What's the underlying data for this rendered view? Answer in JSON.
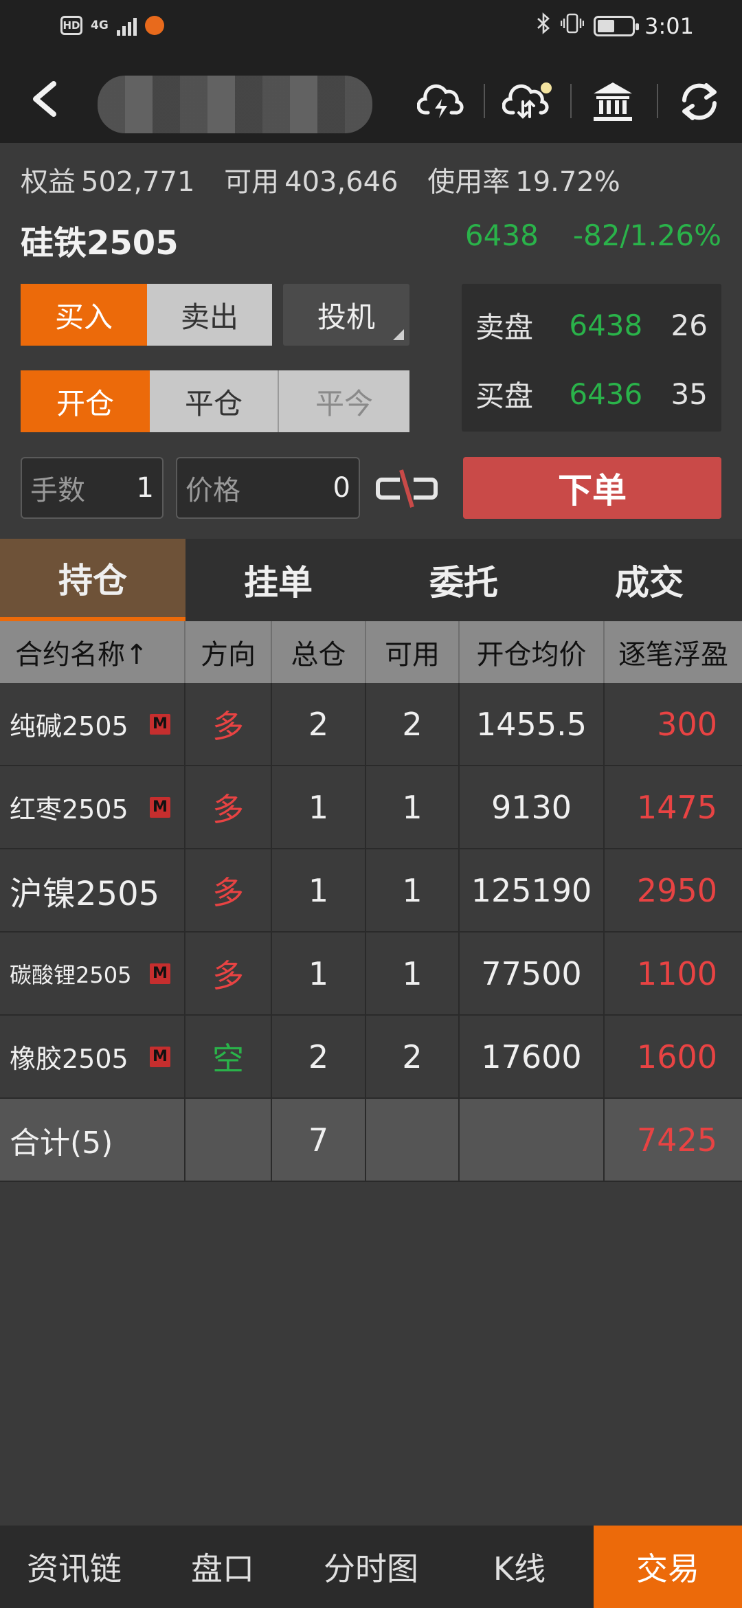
{
  "status_bar": {
    "hd": "HD",
    "network": "4G",
    "time": "3:01",
    "battery_level": 0.45,
    "icons": [
      "hd-icon",
      "signal-icon",
      "app-icon",
      "bluetooth-icon",
      "vibrate-icon",
      "battery-icon"
    ]
  },
  "nav": {
    "icons": [
      "back-icon",
      "cloud-flash-icon",
      "cloud-sync-icon",
      "bank-icon",
      "refresh-icon"
    ],
    "notification_dot_color": "#f3e3a0"
  },
  "account": {
    "equity_label": "权益",
    "equity": "502,771",
    "available_label": "可用",
    "available": "403,646",
    "usage_label": "使用率",
    "usage": "19.72%"
  },
  "contract": {
    "name": "硅铁2505",
    "price": "6438",
    "change": "-82/1.26%"
  },
  "order": {
    "buy": "买入",
    "sell": "卖出",
    "speculation": "投机",
    "open": "开仓",
    "close": "平仓",
    "close_today": "平今",
    "lots_placeholder": "手数",
    "lots_value": "1",
    "price_placeholder": "价格",
    "price_value": "0",
    "submit": "下单"
  },
  "order_book": {
    "ask_label": "卖盘",
    "ask_price": "6438",
    "ask_qty": "26",
    "bid_label": "买盘",
    "bid_price": "6436",
    "bid_qty": "35"
  },
  "tabs": [
    "持仓",
    "挂单",
    "委托",
    "成交"
  ],
  "table": {
    "headers": [
      "合约名称↑",
      "方向",
      "总仓",
      "可用",
      "开仓均价",
      "逐笔浮盈"
    ],
    "rows": [
      {
        "name": "纯碱2505",
        "tag": "M",
        "dir": "多",
        "total": "2",
        "avail": "2",
        "avg": "1455.5",
        "pnl": "300"
      },
      {
        "name": "红枣2505",
        "tag": "M",
        "dir": "多",
        "total": "1",
        "avail": "1",
        "avg": "9130",
        "pnl": "1475"
      },
      {
        "name": "沪镍2505",
        "tag": "",
        "dir": "多",
        "total": "1",
        "avail": "1",
        "avg": "125190",
        "pnl": "2950"
      },
      {
        "name": "碳酸锂2505",
        "tag": "M",
        "dir": "多",
        "total": "1",
        "avail": "1",
        "avg": "77500",
        "pnl": "1100"
      },
      {
        "name": "橡胶2505",
        "tag": "M",
        "dir": "空",
        "total": "2",
        "avail": "2",
        "avg": "17600",
        "pnl": "1600"
      }
    ],
    "total": {
      "label": "合计(5)",
      "total": "7",
      "pnl": "7425"
    }
  },
  "bottom_nav": [
    "资讯链",
    "盘口",
    "分时图",
    "K线",
    "交易"
  ],
  "colors": {
    "accent": "#ec6a0a",
    "up_red": "#e84343",
    "down_green": "#2ab34a",
    "submit_red": "#c94a48"
  }
}
